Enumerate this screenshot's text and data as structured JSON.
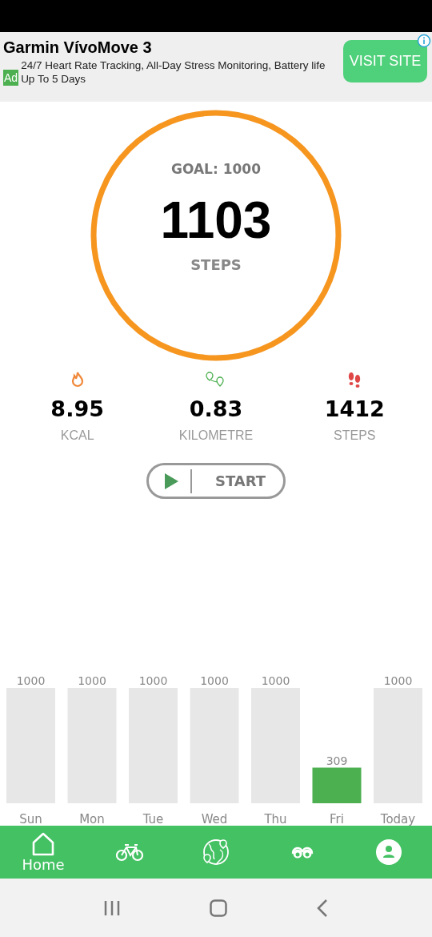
{
  "ad": {
    "title": "Garmin VívoMove 3",
    "badge": "Ad",
    "text": "24/7 Heart Rate Tracking, All-Day Stress Monitoring, Battery life Up To 5 Days",
    "button": "VISIT SITE"
  },
  "goal_ring": {
    "goal": "GOAL: 1000",
    "count": "1103",
    "unit": "STEPS",
    "level": 1
  },
  "stats": [
    {
      "kind": "calories",
      "value": "8.95",
      "label": "KCAL"
    },
    {
      "kind": "distance",
      "value": "0.83",
      "label": "KILOMETRE"
    },
    {
      "kind": "steps",
      "value": "1412",
      "label": "STEPS"
    }
  ],
  "start_button": "START",
  "weekly": {
    "chart_data": {
      "type": "bar",
      "categories": [
        "Sun",
        "Mon",
        "Tue",
        "Wed",
        "Thu",
        "Fri",
        "Today"
      ],
      "series": [
        {
          "color": "#e6e7e6",
          "values": [
            1000,
            1000,
            1000,
            1000,
            1000,
            null,
            1000
          ]
        },
        {
          "color": "#4caf50",
          "values": [
            null,
            null,
            null,
            null,
            null,
            309,
            null
          ]
        }
      ],
      "ylim": [
        0,
        1000
      ],
      "data_labels": true
    }
  },
  "nav": [
    {
      "kind": "home",
      "label": "Home",
      "selected": true
    },
    {
      "kind": "bike",
      "selected": false
    },
    {
      "kind": "globe",
      "selected": false
    },
    {
      "kind": "binoculars",
      "selected": false
    },
    {
      "kind": "profile",
      "selected": false
    }
  ]
}
